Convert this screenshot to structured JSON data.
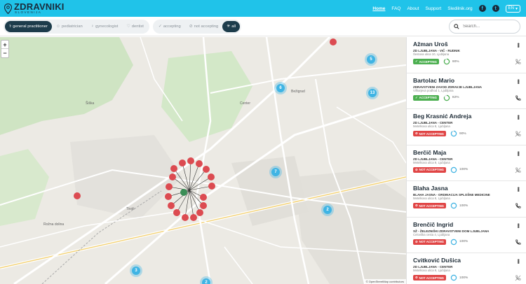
{
  "header": {
    "brand": "ZDRAVNIKI",
    "brand_sub": "SLOVENIJA",
    "nav": [
      "Home",
      "FAQ",
      "About",
      "Support",
      "Sledilnik.org"
    ],
    "active_nav": "Home",
    "social": [
      "facebook-icon",
      "twitter-icon"
    ],
    "language": "EN"
  },
  "filters": {
    "types": [
      {
        "label": "general practitioner",
        "icon": "stethoscope-icon",
        "active": true
      },
      {
        "label": "pediatrician",
        "icon": "child-icon",
        "active": false
      },
      {
        "label": "gynecologist",
        "icon": "female-icon",
        "active": false
      },
      {
        "label": "dentist",
        "icon": "tooth-icon",
        "active": false
      }
    ],
    "accept": [
      {
        "label": "accepting",
        "icon": "check-icon",
        "active": false
      },
      {
        "label": "not accepting",
        "icon": "block-icon",
        "active": false
      },
      {
        "label": "all",
        "icon": "all-icon",
        "active": true
      }
    ]
  },
  "search": {
    "placeholder": "Search..."
  },
  "map": {
    "zoom_in": "+",
    "zoom_out": "−",
    "attribution": "© OpenStreetMap contributors",
    "place_labels": [
      "Šiška",
      "Rožna dolina",
      "Bežigrad",
      "Center",
      "Tivoli"
    ],
    "clusters": [
      {
        "count": "5"
      },
      {
        "count": "6"
      },
      {
        "count": "13"
      },
      {
        "count": "7"
      },
      {
        "count": "2"
      },
      {
        "count": "3"
      },
      {
        "count": "2"
      }
    ]
  },
  "doctors": [
    {
      "name": "Ažman Uroš",
      "institution": "ZD LJUBLJANA - VIČ - RUDNIK",
      "address": "Šestova ulica 10, Ljubljana",
      "status": "ACCEPTING",
      "accepting": true,
      "load_percent": 90,
      "load": "90%",
      "contact_icon": "phone-off-icon"
    },
    {
      "name": "Bartolac Mario",
      "institution": "ZDRAVSTVENI ZAVOD ZDRAVJE LJUBLJANA",
      "address": "Vilharjeva podhod 1, Ljubljana",
      "status": "ACCEPTING",
      "accepting": true,
      "load_percent": 82,
      "load": "82%",
      "contact_icon": "phone-icon"
    },
    {
      "name": "Beg Krasnić Andreja",
      "institution": "ZD LJUBLJANA - CENTER",
      "address": "Metelkova ulica 9, Ljubljana",
      "status": "NOT ACCEPTING",
      "accepting": false,
      "load_percent": 90,
      "load": "90%",
      "contact_icon": "phone-off-icon"
    },
    {
      "name": "Berčič Maja",
      "institution": "ZD LJUBLJANA - CENTER",
      "address": "Metelkova ulica 9, Ljubljana",
      "status": "NOT ACCEPTING",
      "accepting": false,
      "load_percent": 100,
      "load": "100%",
      "contact_icon": "phone-off-icon"
    },
    {
      "name": "Blaha Jasna",
      "institution": "BLAHA JASNA - ORDINACIJA SPLOŠNE MEDICINE",
      "address": "Metelkova ulica 9, Ljubljana",
      "status": "NOT ACCEPTING",
      "accepting": false,
      "load_percent": 100,
      "load": "100%",
      "contact_icon": "phone-icon"
    },
    {
      "name": "Brenčič Ingrid",
      "institution": "SŽ - ŽELEZNIŠKI ZDRAVSTVENI DOM LJUBLJANA",
      "address": "Celovška cesta 4, Ljubljana",
      "status": "NOT ACCEPTING",
      "accepting": false,
      "load_percent": 100,
      "load": "100%",
      "contact_icon": "phone-icon"
    },
    {
      "name": "Cvitković Dušica",
      "institution": "ZD LJUBLJANA - CENTER",
      "address": "Metelkova ulica 9, Ljubljana",
      "status": "NOT ACCEPTING",
      "accepting": false,
      "load_percent": 100,
      "load": "100%",
      "contact_icon": "phone-off-icon"
    }
  ],
  "colors": {
    "header_bg": "#20c3e9",
    "chip_active": "#1d3c4b",
    "accepting": "#4caf50",
    "not_accepting": "#e04545",
    "cluster": "#3fb4e4",
    "marker_red": "#dc4b51",
    "marker_green": "#3b8e57"
  }
}
